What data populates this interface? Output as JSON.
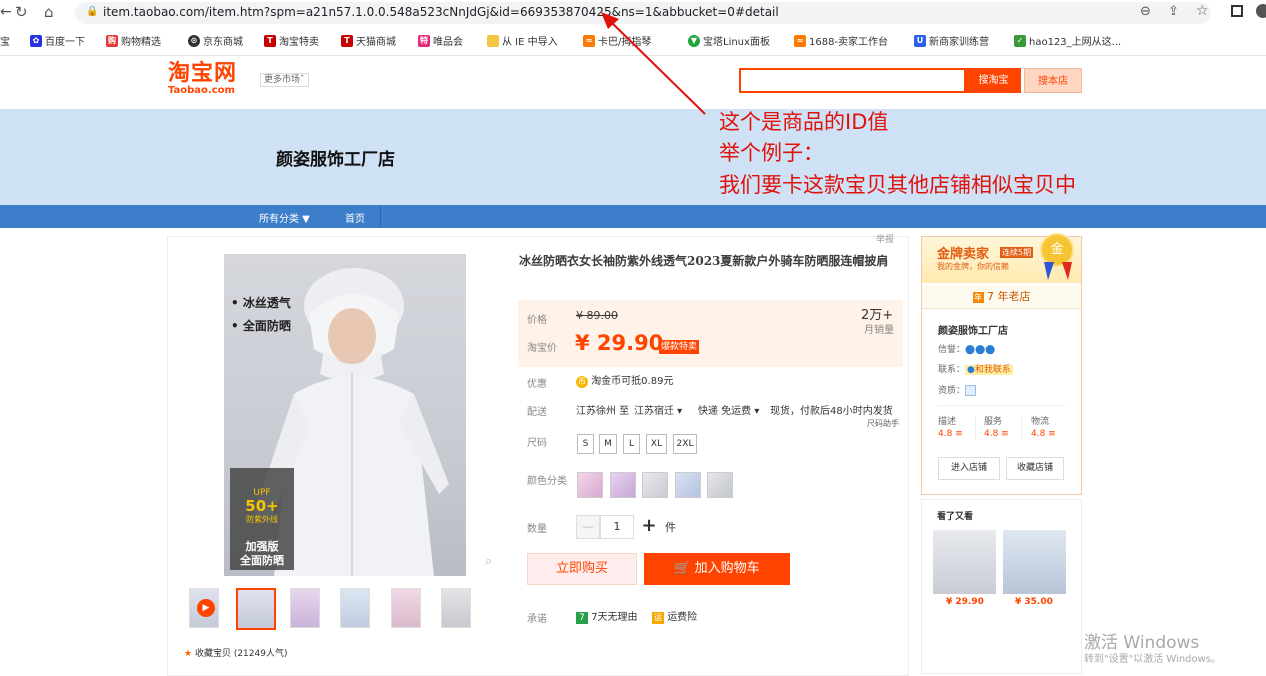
{
  "browser": {
    "url": "item.taobao.com/item.htm?spm=a21n57.1.0.0.548a523cNnJdGj&id=669353870425&ns=1&abbucket=0#detail",
    "bookmarks": [
      "宝",
      "百度一下",
      "购物精选",
      "京东商城",
      "淘宝特卖",
      "天猫商城",
      "唯品会",
      "从 IE 中导入",
      "卡巴/拇指琴",
      "宝塔Linux面板",
      "1688-卖家工作台",
      "新商家训练营",
      "hao123_上网从这..."
    ]
  },
  "header": {
    "logo_cn": "淘宝网",
    "logo_en": "Taobao.com",
    "more_markets": "更多市场",
    "search_taobao": "搜淘宝",
    "search_shop": "搜本店"
  },
  "shop": {
    "banner_title": "颜姿服饰工厂店"
  },
  "nav": {
    "all_categories": "所有分类 ▼",
    "home": "首页"
  },
  "annotation": {
    "line1": "这个是商品的ID值",
    "line2": "举个例子：",
    "line3": "我们要卡这款宝贝其他店铺相似宝贝中"
  },
  "product": {
    "report": "举报",
    "title": "冰丝防晒衣女长袖防紫外线透气2023夏新款户外骑车防晒服连帽披肩",
    "image_text1": "• 冰丝透气",
    "image_text2": "• 全面防晒",
    "upf_badge": "UPF",
    "upf_value": "50+",
    "upf_sub": "防紫外线",
    "upf_strong1": "加强版",
    "upf_strong2": "全面防晒",
    "favorite": "收藏宝贝 (21249人气)",
    "price_label": "价格",
    "original_price": "¥ 89.00",
    "monthly_sales": "2万+",
    "monthly_sales_label": "月销量",
    "taobao_price_label": "淘宝价",
    "price": "¥ 29.90",
    "price_badge": "爆款特卖",
    "discount_label": "优惠",
    "discount_value": "淘金币可抵0.89元",
    "delivery_label": "配送",
    "delivery_from": "江苏徐州 至",
    "delivery_to": "江苏宿迁 ▾",
    "delivery_fee": "快递 免运费 ▾",
    "delivery_time": "现货，付款后48小时内发货",
    "size_helper": "尺码助手",
    "size_label": "尺码",
    "sizes": [
      "S",
      "M",
      "L",
      "XL",
      "2XL"
    ],
    "color_label": "颜色分类",
    "qty_label": "数量",
    "qty_minus": "—",
    "qty": "1",
    "qty_plus": "+",
    "qty_unit": "件",
    "buy_now": "立即购买",
    "add_cart": "加入购物车",
    "promise_label": "承诺",
    "promise1": "7天无理由",
    "promise2": "运费险"
  },
  "seller": {
    "gold_title": "金牌卖家",
    "gold_badge": "连续5期",
    "gold_sub": "我的金牌，你的信赖",
    "gold_medal": "金",
    "years": "7 年老店",
    "shop_name": "颜姿服饰工厂店",
    "credit_label": "信誉：",
    "contact_label": "联系：",
    "contact_value": "和我联系",
    "qual_label": "资质：",
    "score_desc_label": "描述",
    "score_desc": "4.8 ≡",
    "score_service_label": "服务",
    "score_service": "4.8 ≡",
    "score_logistics_label": "物流",
    "score_logistics": "4.8 ≡",
    "enter_shop": "进入店铺",
    "fav_shop": "收藏店铺",
    "also_viewed": "看了又看",
    "rec1_price": "¥ 29.90",
    "rec2_price": "¥ 35.00"
  },
  "watermark": {
    "line1": "激活 Windows",
    "line2": "转到\"设置\"以激活 Windows。"
  },
  "colors": {
    "taobao_orange": "#ff4400",
    "nav_blue": "#3c7ec9",
    "banner_blue": "#cfe1f5",
    "annotation_red": "#e0120b"
  }
}
